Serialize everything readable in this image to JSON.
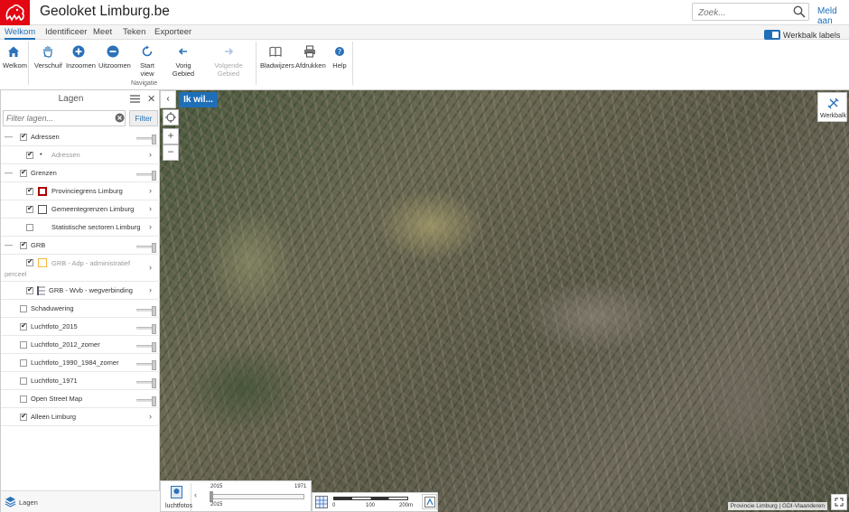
{
  "header": {
    "title": "Geoloket Limburg.be",
    "search_placeholder": "Zoek...",
    "login": "Meld aan",
    "logo_color": "#e30613"
  },
  "menu": {
    "tabs": [
      "Welkom",
      "Identificeer",
      "Meet",
      "Teken",
      "Exporteer"
    ],
    "active": "Welkom",
    "toolbar_labels_toggle": "Werkbalk labels"
  },
  "ribbon": {
    "buttons": [
      {
        "label": "Welkom",
        "icon": "home-icon"
      },
      {
        "label": "Verschuif",
        "icon": "hand-icon"
      },
      {
        "label": "Inzoomen",
        "icon": "zoom-in-icon"
      },
      {
        "label": "Uitzoomen",
        "icon": "zoom-out-icon"
      },
      {
        "label": "Start view",
        "icon": "refresh-icon"
      },
      {
        "label": "Vorig Gebied",
        "icon": "arrow-left-icon"
      },
      {
        "label": "Volgende Gebied",
        "icon": "arrow-right-icon",
        "disabled": true
      },
      {
        "label": "Bladwijzers",
        "icon": "book-icon"
      },
      {
        "label": "Afdrukken",
        "icon": "printer-icon"
      },
      {
        "label": "Help",
        "icon": "help-icon"
      }
    ],
    "group_label": "Navigatie",
    "accent": "#1f6fb8"
  },
  "panel": {
    "title": "Lagen",
    "filter_placeholder": "Filter lagen...",
    "filter_button": "Filter",
    "footer_label": "Lagen",
    "layers": [
      {
        "name": "Adressen",
        "checked": true
      },
      {
        "name": "Adressen",
        "checked": true
      },
      {
        "name": "Grenzen",
        "checked": true
      },
      {
        "name": "Provinciegrens Limburg",
        "checked": true
      },
      {
        "name": "Gemeentegrenzen Limburg",
        "checked": true
      },
      {
        "name": "Statistische sectoren Limburg",
        "checked": false
      },
      {
        "name": "GRB",
        "checked": true
      },
      {
        "name": "GRB - Adp - administratief perceel",
        "checked": true
      },
      {
        "name": "GRB - Wvb - wegverbinding",
        "checked": true
      },
      {
        "name": "Schaduwering",
        "checked": false
      },
      {
        "name": "Luchtfoto_2015",
        "checked": true
      },
      {
        "name": "Luchtfoto_2012_zomer",
        "checked": false
      },
      {
        "name": "Luchtfoto_1990_1984_zomer",
        "checked": false
      },
      {
        "name": "Luchtfoto_1971",
        "checked": false
      },
      {
        "name": "Open Street Map",
        "checked": false
      },
      {
        "name": "Alleen Limburg",
        "checked": true
      }
    ]
  },
  "map": {
    "ik_wil": "Ik wil...",
    "werkbalk": "Werkbalk",
    "basemap_label": "luchtfotos",
    "timeline": {
      "start": "2015",
      "end": "1971",
      "selected": "2015"
    },
    "scale_labels": [
      "0",
      "100",
      "200m"
    ],
    "copyright": "Provincie Limburg | GDI-Vlaanderen"
  }
}
